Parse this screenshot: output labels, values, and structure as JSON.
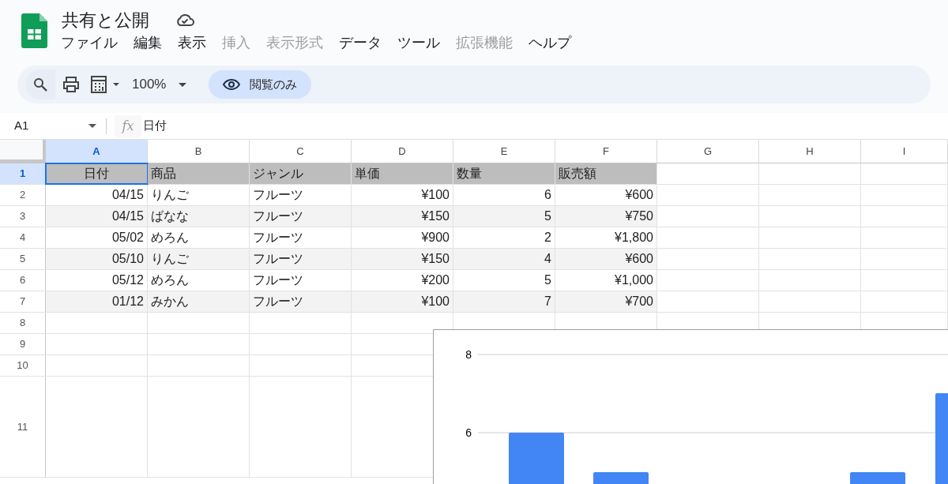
{
  "document": {
    "title": "共有と公開"
  },
  "menu": [
    {
      "label": "ファイル",
      "disabled": false
    },
    {
      "label": "編集",
      "disabled": false
    },
    {
      "label": "表示",
      "disabled": false
    },
    {
      "label": "挿入",
      "disabled": true
    },
    {
      "label": "表示形式",
      "disabled": true
    },
    {
      "label": "データ",
      "disabled": false
    },
    {
      "label": "ツール",
      "disabled": false
    },
    {
      "label": "拡張機能",
      "disabled": true
    },
    {
      "label": "ヘルプ",
      "disabled": false
    }
  ],
  "toolbar": {
    "zoom": "100%",
    "mode_button": "閲覧のみ"
  },
  "formula_bar": {
    "cell_ref": "A1",
    "function_label": "fx",
    "value": "日付"
  },
  "columns": [
    {
      "label": "A",
      "selected": true
    },
    {
      "label": "B",
      "selected": false
    },
    {
      "label": "C",
      "selected": false
    },
    {
      "label": "D",
      "selected": false
    },
    {
      "label": "E",
      "selected": false
    },
    {
      "label": "F",
      "selected": false
    },
    {
      "label": "G",
      "selected": false
    },
    {
      "label": "H",
      "selected": false
    },
    {
      "label": "I",
      "selected": false
    }
  ],
  "rows": [
    {
      "number": "1",
      "selected": true,
      "kind": "header",
      "cells": [
        "日付",
        "商品",
        "ジャンル",
        "単価",
        "数量",
        "販売額"
      ]
    },
    {
      "number": "2",
      "selected": false,
      "kind": "data",
      "shaded": false,
      "cells": [
        "04/15",
        "りんご",
        "フルーツ",
        "¥100",
        "6",
        "¥600"
      ]
    },
    {
      "number": "3",
      "selected": false,
      "kind": "data",
      "shaded": true,
      "cells": [
        "04/15",
        "ばなな",
        "フルーツ",
        "¥150",
        "5",
        "¥750"
      ]
    },
    {
      "number": "4",
      "selected": false,
      "kind": "data",
      "shaded": false,
      "cells": [
        "05/02",
        "めろん",
        "フルーツ",
        "¥900",
        "2",
        "¥1,800"
      ]
    },
    {
      "number": "5",
      "selected": false,
      "kind": "data",
      "shaded": true,
      "cells": [
        "05/10",
        "りんご",
        "フルーツ",
        "¥150",
        "4",
        "¥600"
      ]
    },
    {
      "number": "6",
      "selected": false,
      "kind": "data",
      "shaded": false,
      "cells": [
        "05/12",
        "めろん",
        "フルーツ",
        "¥200",
        "5",
        "¥1,000"
      ]
    },
    {
      "number": "7",
      "selected": false,
      "kind": "data",
      "shaded": true,
      "cells": [
        "01/12",
        "みかん",
        "フルーツ",
        "¥100",
        "7",
        "¥700"
      ]
    },
    {
      "number": "8",
      "selected": false,
      "kind": "empty",
      "cells": []
    },
    {
      "number": "9",
      "selected": false,
      "kind": "empty",
      "cells": []
    },
    {
      "number": "10",
      "selected": false,
      "kind": "empty",
      "cells": []
    },
    {
      "number": "11",
      "selected": false,
      "kind": "tall",
      "cells": []
    }
  ],
  "chart": {
    "axis_labels": [
      "8",
      "6"
    ]
  }
}
